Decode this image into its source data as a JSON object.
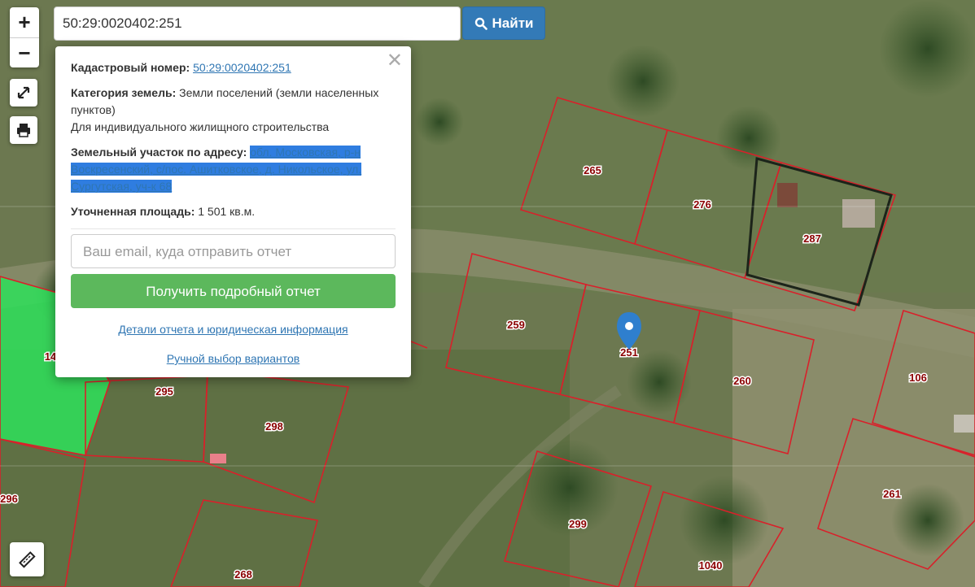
{
  "search": {
    "value": "50:29:0020402:251",
    "button_label": "Найти"
  },
  "controls": {
    "zoom_in": "+",
    "zoom_out": "−"
  },
  "popup": {
    "cadastral_label": "Кадастровый номер:",
    "cadastral_value": "50:29:0020402:251",
    "category_label": "Категория земель:",
    "category_value": "Земли поселений (земли населенных пунктов)",
    "usage": "Для индивидуального жилищного строительства",
    "address_label": "Земельный участок по адресу:",
    "address_value": "обл. Московская, р-н Воскресенский, с/пос. Ашитковское, д. Никольское, ул. Сургутская, уч-к 68",
    "area_label": "Уточненная площадь:",
    "area_value": "1 501 кв.м.",
    "email_placeholder": "Ваш email, куда отправить отчет",
    "report_button": "Получить подробный отчет",
    "details_link": "Детали отчета и юридическая информация",
    "manual_link": "Ручной выбор вариантов"
  },
  "parcels": [
    "265",
    "276",
    "287",
    "259",
    "251",
    "260",
    "106",
    "295",
    "298",
    "296",
    "299",
    "261",
    "1040",
    "268",
    "14"
  ],
  "colors": {
    "parcel_border": "#d9202a",
    "selected_parcel": "#2ee05a",
    "marker": "#2f7fce",
    "search_button": "#337ab7",
    "report_button": "#5cb85c"
  }
}
